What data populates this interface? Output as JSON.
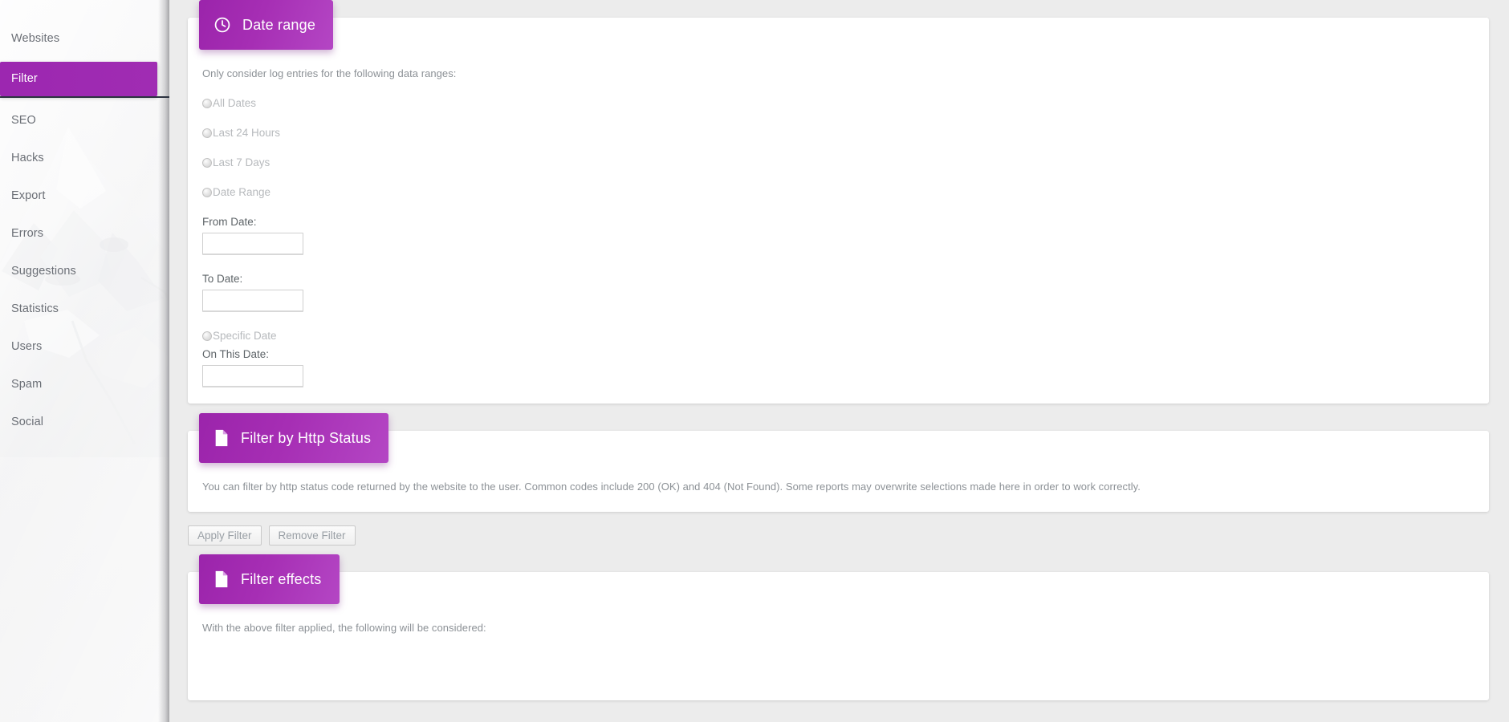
{
  "theme": {
    "accent": "#9c27b0",
    "accent_light": "#b446c4",
    "page_bg": "#ececec"
  },
  "sidebar": {
    "items": [
      {
        "label": "Websites",
        "active": false
      },
      {
        "label": "Filter",
        "active": true
      },
      {
        "label": "SEO",
        "active": false
      },
      {
        "label": "Hacks",
        "active": false
      },
      {
        "label": "Export",
        "active": false
      },
      {
        "label": "Errors",
        "active": false
      },
      {
        "label": "Suggestions",
        "active": false
      },
      {
        "label": "Statistics",
        "active": false
      },
      {
        "label": "Users",
        "active": false
      },
      {
        "label": "Spam",
        "active": false
      },
      {
        "label": "Social",
        "active": false
      }
    ]
  },
  "date_range_panel": {
    "icon": "clock-icon",
    "title": "Date range",
    "hint": "Only consider log entries for the following data ranges:",
    "options": [
      {
        "label": "All Dates",
        "selected": false
      },
      {
        "label": "Last 24 Hours",
        "selected": false
      },
      {
        "label": "Last 7 Days",
        "selected": false
      },
      {
        "label": "Date Range",
        "selected": false
      }
    ],
    "from_date": {
      "label": "From Date:",
      "value": "",
      "placeholder": ""
    },
    "to_date": {
      "label": "To Date:",
      "value": "",
      "placeholder": ""
    },
    "specific_date_option": {
      "label": "Specific Date",
      "selected": false
    },
    "on_this_date": {
      "label": "On This Date:",
      "value": "",
      "placeholder": ""
    }
  },
  "http_status_panel": {
    "icon": "file-icon",
    "title": "Filter by Http Status",
    "body": "You can filter by http status code returned by the website to the user. Common codes include 200 (OK) and 404 (Not Found). Some reports may overwrite selections made here in order to work correctly."
  },
  "actions": {
    "apply_label": "Apply Filter",
    "remove_label": "Remove Filter"
  },
  "filter_effects_panel": {
    "icon": "file-icon",
    "title": "Filter effects",
    "body": "With the above filter applied, the following will be considered:"
  }
}
